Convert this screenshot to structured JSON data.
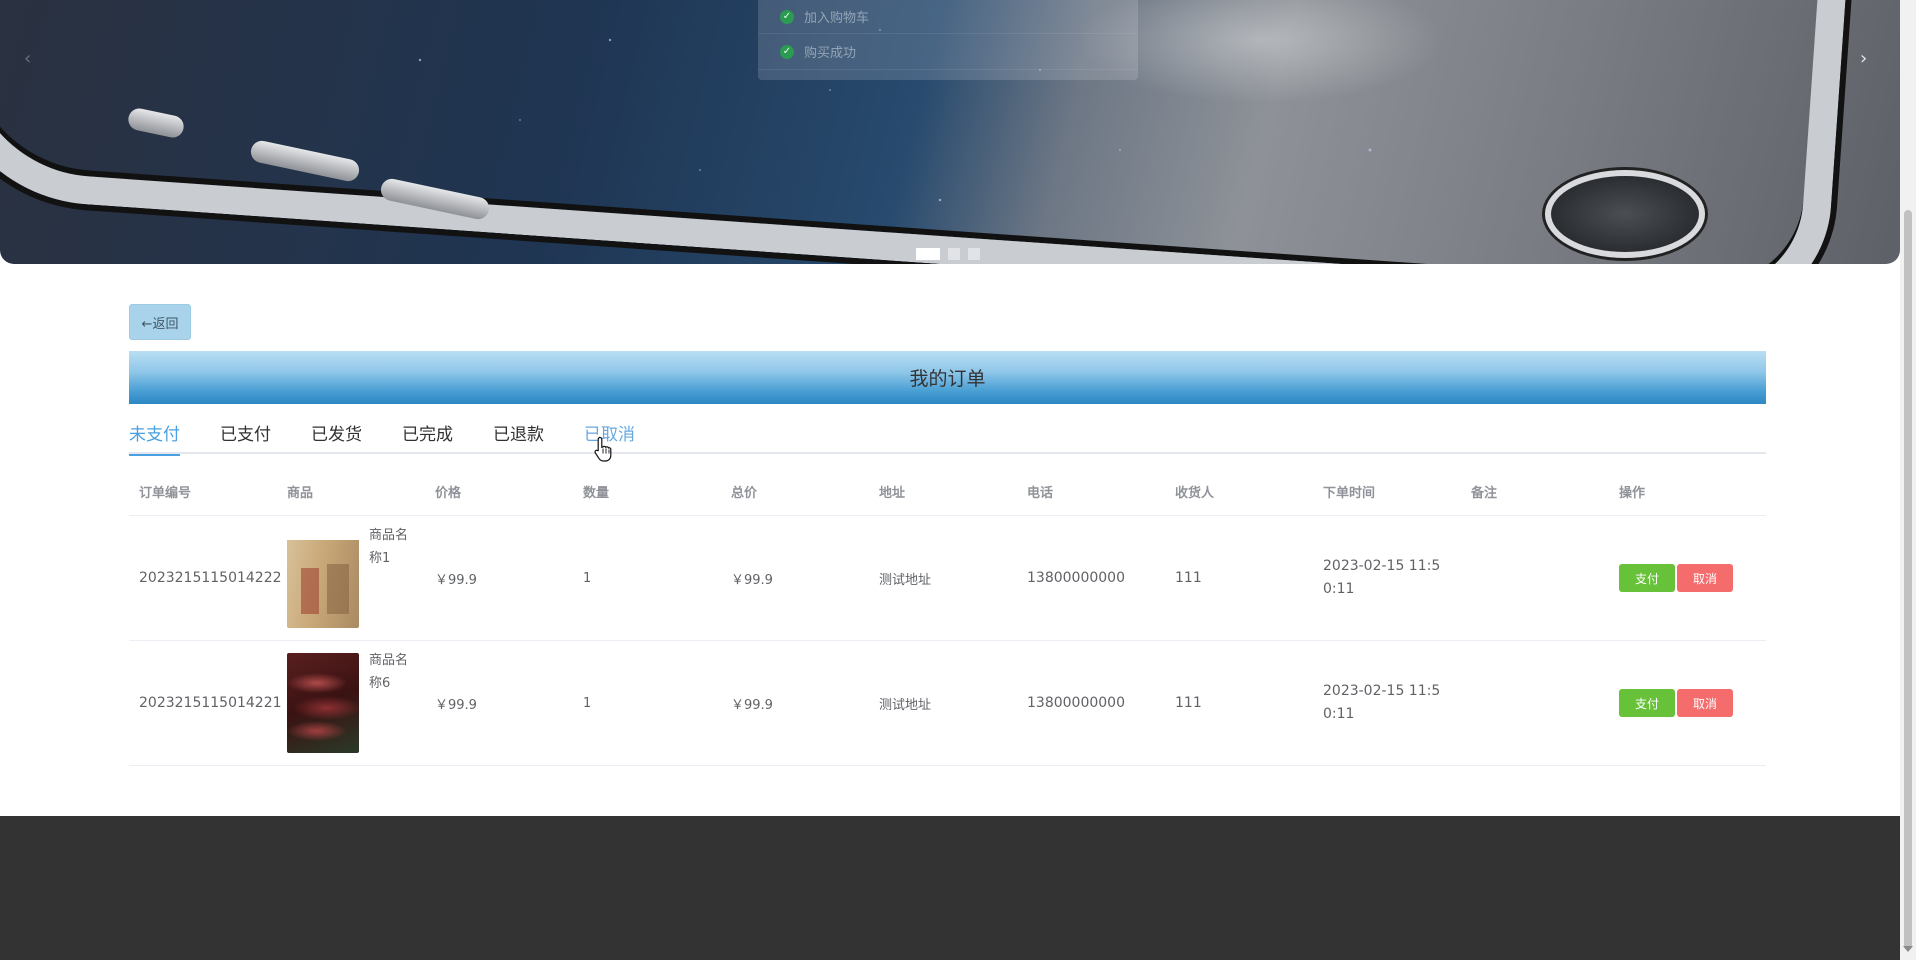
{
  "banner": {
    "toasts": [
      {
        "text": "加入购物车"
      },
      {
        "text": "购买成功"
      }
    ],
    "arrow_left": "‹",
    "arrow_right": "›",
    "slides": 3,
    "active_slide": 1
  },
  "back_button": {
    "label": "←返回"
  },
  "page_title": "我的订单",
  "tabs": [
    {
      "label": "未支付",
      "active": true
    },
    {
      "label": "已支付"
    },
    {
      "label": "已发货"
    },
    {
      "label": "已完成"
    },
    {
      "label": "已退款"
    },
    {
      "label": "已取消"
    }
  ],
  "table": {
    "headers": [
      "订单编号",
      "商品",
      "价格",
      "数量",
      "总价",
      "地址",
      "电话",
      "收货人",
      "下单时间",
      "备注",
      "操作"
    ],
    "rows": [
      {
        "order_no": "2023215115014222",
        "goods_name": "商品名称1",
        "price": "￥99.9",
        "quantity": "1",
        "total": "￥99.9",
        "address": "测试地址",
        "phone": "13800000000",
        "receiver": "111",
        "time": "2023-02-15 11:50:11",
        "remark": "",
        "pay_label": "支付",
        "cancel_label": "取消"
      },
      {
        "order_no": "2023215115014221",
        "goods_name": "商品名称6",
        "price": "￥99.9",
        "quantity": "1",
        "total": "￥99.9",
        "address": "测试地址",
        "phone": "13800000000",
        "receiver": "111",
        "time": "2023-02-15 11:50:11",
        "remark": "",
        "pay_label": "支付",
        "cancel_label": "取消"
      }
    ]
  },
  "colors": {
    "accent": "#4aa0e0",
    "pay": "#67c23a",
    "cancel": "#f56c6c",
    "footer": "#333333"
  }
}
